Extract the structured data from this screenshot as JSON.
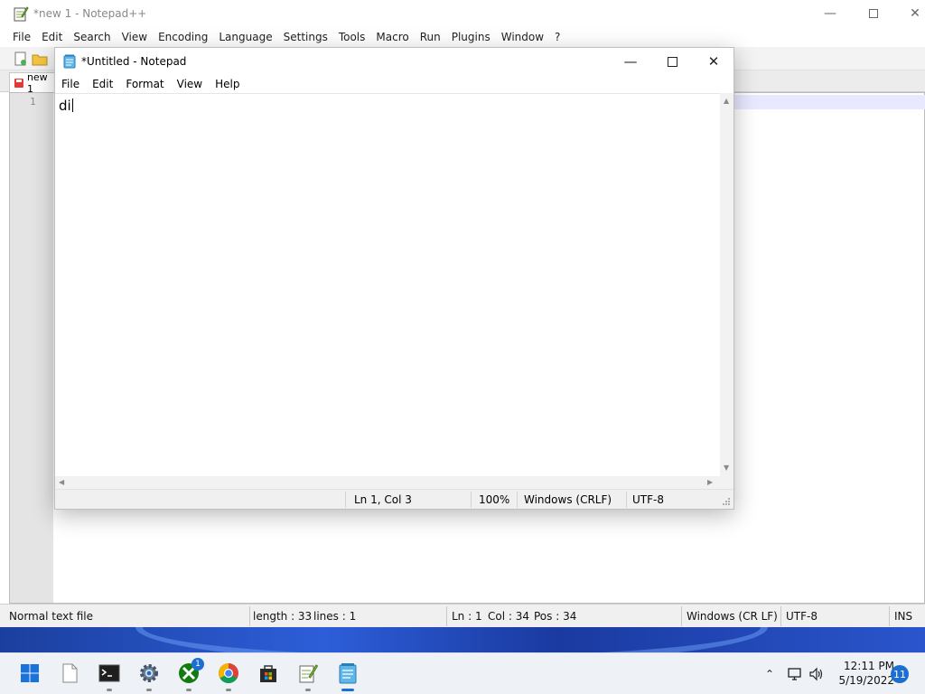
{
  "npp": {
    "title": "*new 1 - Notepad++",
    "menu": [
      "File",
      "Edit",
      "Search",
      "View",
      "Encoding",
      "Language",
      "Settings",
      "Tools",
      "Macro",
      "Run",
      "Plugins",
      "Window",
      "?"
    ],
    "tab_label": "new 1",
    "line_number": "1",
    "status": {
      "file_type": "Normal text file",
      "length": "length : 33",
      "lines": "lines : 1",
      "ln": "Ln : 1",
      "col": "Col : 34",
      "pos": "Pos : 34",
      "eol": "Windows (CR LF)",
      "encoding": "UTF-8",
      "mode": "INS"
    }
  },
  "notepad": {
    "title": "*Untitled - Notepad",
    "menu": [
      "File",
      "Edit",
      "Format",
      "View",
      "Help"
    ],
    "text": "di",
    "status": {
      "position": "Ln 1, Col 3",
      "zoom": "100%",
      "eol": "Windows (CRLF)",
      "encoding": "UTF-8"
    }
  },
  "taskbar": {
    "xbox_badge": "1",
    "time": "12:11 PM",
    "date": "5/19/2022",
    "notifications": "11"
  },
  "colors": {
    "accent": "#1c6fd1",
    "current_line": "#e8e8ff"
  }
}
